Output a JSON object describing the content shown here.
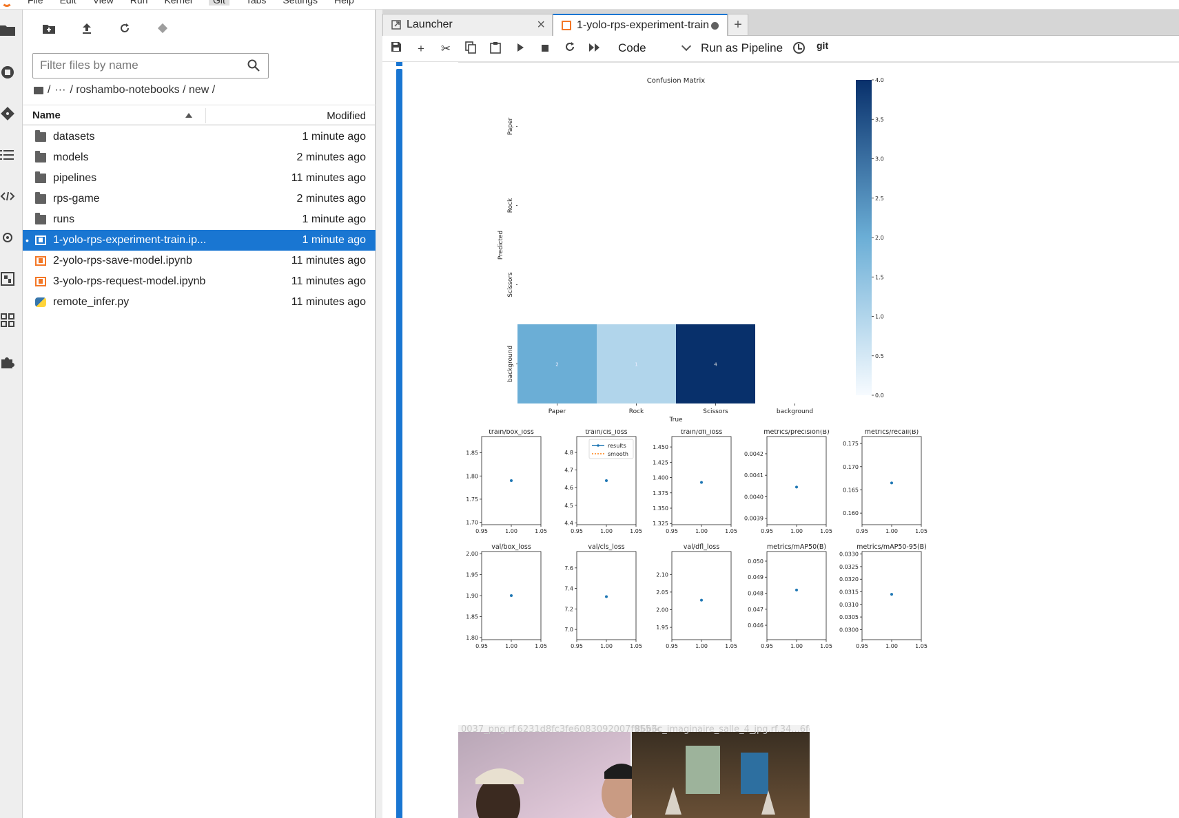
{
  "menubar": {
    "items": [
      "File",
      "Edit",
      "View",
      "Run",
      "Kernel",
      "Git",
      "Tabs",
      "Settings",
      "Help"
    ],
    "active": "Git"
  },
  "filebrowser": {
    "filter_placeholder": "Filter files by name",
    "breadcrumb": [
      "/",
      "···",
      "/ roshambo-notebooks / new /"
    ],
    "header": {
      "name": "Name",
      "modified": "Modified"
    },
    "files": [
      {
        "name": "datasets",
        "type": "folder",
        "modified": "1 minute ago"
      },
      {
        "name": "models",
        "type": "folder",
        "modified": "2 minutes ago"
      },
      {
        "name": "pipelines",
        "type": "folder",
        "modified": "11 minutes ago"
      },
      {
        "name": "rps-game",
        "type": "folder",
        "modified": "2 minutes ago"
      },
      {
        "name": "runs",
        "type": "folder",
        "modified": "1 minute ago"
      },
      {
        "name": "1-yolo-rps-experiment-train.ip...",
        "type": "notebook",
        "modified": "1 minute ago",
        "selected": true,
        "running_dot": "•"
      },
      {
        "name": "2-yolo-rps-save-model.ipynb",
        "type": "notebook",
        "modified": "11 minutes ago"
      },
      {
        "name": "3-yolo-rps-request-model.ipynb",
        "type": "notebook",
        "modified": "11 minutes ago"
      },
      {
        "name": "remote_infer.py",
        "type": "python",
        "modified": "11 minutes ago"
      }
    ]
  },
  "tabs": [
    {
      "label": "Launcher"
    },
    {
      "label": "1-yolo-rps-experiment-train"
    }
  ],
  "toolbar": {
    "cell_type": "Code",
    "run_pipeline": "Run as Pipeline",
    "git": "git"
  },
  "colors": {
    "accent": "#1976d2",
    "notebook_orange": "#f37726",
    "series_blue": "#1f77b4",
    "series_orange": "#ff7f0e"
  },
  "chart_data": [
    {
      "type": "heatmap",
      "title": "Confusion Matrix",
      "xlabel": "True",
      "ylabel": "Predicted",
      "x_categories": [
        "Paper",
        "Rock",
        "Scissors",
        "background"
      ],
      "y_categories": [
        "Paper",
        "Rock",
        "Scissors",
        "background"
      ],
      "cells": [
        {
          "row": "background",
          "col": "Paper",
          "value": 2
        },
        {
          "row": "background",
          "col": "Rock",
          "value": 1
        },
        {
          "row": "background",
          "col": "Scissors",
          "value": 4
        }
      ],
      "colorbar": {
        "min": 0.0,
        "max": 4.0,
        "ticks": [
          "0.0",
          "0.5",
          "1.0",
          "1.5",
          "2.0",
          "2.5",
          "3.0",
          "3.5",
          "4.0"
        ]
      },
      "cmap": [
        "#f7fbff",
        "#08306b"
      ]
    },
    {
      "type": "scatter",
      "title": "train/box_loss",
      "x": [
        1.0
      ],
      "y": [
        1.79
      ],
      "xlim": [
        0.95,
        1.05
      ],
      "xticks": [
        "0.95",
        "1.00",
        "1.05"
      ],
      "yticks": [
        "1.70",
        "1.75",
        "1.80",
        "1.85"
      ],
      "ytick_vals": [
        1.7,
        1.75,
        1.8,
        1.85
      ],
      "ylim": [
        1.695,
        1.885
      ]
    },
    {
      "type": "scatter",
      "title": "train/cls_loss",
      "x": [
        1.0
      ],
      "y": [
        4.64
      ],
      "xlim": [
        0.95,
        1.05
      ],
      "xticks": [
        "0.95",
        "1.00",
        "1.05"
      ],
      "yticks": [
        "4.4",
        "4.5",
        "4.6",
        "4.7",
        "4.8"
      ],
      "ytick_vals": [
        4.4,
        4.5,
        4.6,
        4.7,
        4.8
      ],
      "ylim": [
        4.39,
        4.89
      ],
      "legend": [
        "results",
        "smooth"
      ]
    },
    {
      "type": "scatter",
      "title": "train/dfl_loss",
      "x": [
        1.0
      ],
      "y": [
        1.392
      ],
      "xlim": [
        0.95,
        1.05
      ],
      "xticks": [
        "0.95",
        "1.00",
        "1.05"
      ],
      "yticks": [
        "1.325",
        "1.350",
        "1.375",
        "1.400",
        "1.425",
        "1.450"
      ],
      "ytick_vals": [
        1.325,
        1.35,
        1.375,
        1.4,
        1.425,
        1.45
      ],
      "ylim": [
        1.323,
        1.467
      ]
    },
    {
      "type": "scatter",
      "title": "metrics/precision(B)",
      "x": [
        1.0
      ],
      "y": [
        0.004045
      ],
      "xlim": [
        0.95,
        1.05
      ],
      "xticks": [
        "0.95",
        "1.00",
        "1.05"
      ],
      "yticks": [
        "0.0039",
        "0.0040",
        "0.0041",
        "0.0042"
      ],
      "ytick_vals": [
        0.0039,
        0.004,
        0.0041,
        0.0042
      ],
      "ylim": [
        0.00387,
        0.00428
      ]
    },
    {
      "type": "scatter",
      "title": "metrics/recall(B)",
      "x": [
        1.0
      ],
      "y": [
        0.1665
      ],
      "xlim": [
        0.95,
        1.05
      ],
      "xticks": [
        "0.95",
        "1.00",
        "1.05"
      ],
      "yticks": [
        "0.160",
        "0.165",
        "0.170",
        "0.175"
      ],
      "ytick_vals": [
        0.16,
        0.165,
        0.17,
        0.175
      ],
      "ylim": [
        0.1575,
        0.1765
      ]
    },
    {
      "type": "scatter",
      "title": "val/box_loss",
      "x": [
        1.0
      ],
      "y": [
        1.9
      ],
      "xlim": [
        0.95,
        1.05
      ],
      "xticks": [
        "0.95",
        "1.00",
        "1.05"
      ],
      "yticks": [
        "1.80",
        "1.85",
        "1.90",
        "1.95",
        "2.00"
      ],
      "ytick_vals": [
        1.8,
        1.85,
        1.9,
        1.95,
        2.0
      ],
      "ylim": [
        1.795,
        2.005
      ]
    },
    {
      "type": "scatter",
      "title": "val/cls_loss",
      "x": [
        1.0
      ],
      "y": [
        7.32
      ],
      "xlim": [
        0.95,
        1.05
      ],
      "xticks": [
        "0.95",
        "1.00",
        "1.05"
      ],
      "yticks": [
        "7.0",
        "7.2",
        "7.4",
        "7.6"
      ],
      "ytick_vals": [
        7.0,
        7.2,
        7.4,
        7.6
      ],
      "ylim": [
        6.9,
        7.76
      ]
    },
    {
      "type": "scatter",
      "title": "val/dfl_loss",
      "x": [
        1.0
      ],
      "y": [
        2.027
      ],
      "xlim": [
        0.95,
        1.05
      ],
      "xticks": [
        "0.95",
        "1.00",
        "1.05"
      ],
      "yticks": [
        "1.95",
        "2.00",
        "2.05",
        "2.10"
      ],
      "ytick_vals": [
        1.95,
        2.0,
        2.05,
        2.1
      ],
      "ylim": [
        1.915,
        2.165
      ]
    },
    {
      "type": "scatter",
      "title": "metrics/mAP50(B)",
      "x": [
        1.0
      ],
      "y": [
        0.0482
      ],
      "xlim": [
        0.95,
        1.05
      ],
      "xticks": [
        "0.95",
        "1.00",
        "1.05"
      ],
      "yticks": [
        "0.046",
        "0.047",
        "0.048",
        "0.049",
        "0.050"
      ],
      "ytick_vals": [
        0.046,
        0.047,
        0.048,
        0.049,
        0.05
      ],
      "ylim": [
        0.0451,
        0.0506
      ]
    },
    {
      "type": "scatter",
      "title": "metrics/mAP50-95(B)",
      "x": [
        1.0
      ],
      "y": [
        0.0314
      ],
      "xlim": [
        0.95,
        1.05
      ],
      "xticks": [
        "0.95",
        "1.00",
        "1.05"
      ],
      "yticks": [
        "0.0300",
        "0.0305",
        "0.0310",
        "0.0315",
        "0.0320",
        "0.0325",
        "0.0330"
      ],
      "ytick_vals": [
        0.03,
        0.0305,
        0.031,
        0.0315,
        0.032,
        0.0325,
        0.033
      ],
      "ylim": [
        0.0296,
        0.0331
      ]
    }
  ],
  "image_captions": [
    "0037_png.rf.6231d8fc3fe6083092007f9553c",
    "86b6c_imaginaire_salle_4_jpg.rf.34...6fc5"
  ]
}
